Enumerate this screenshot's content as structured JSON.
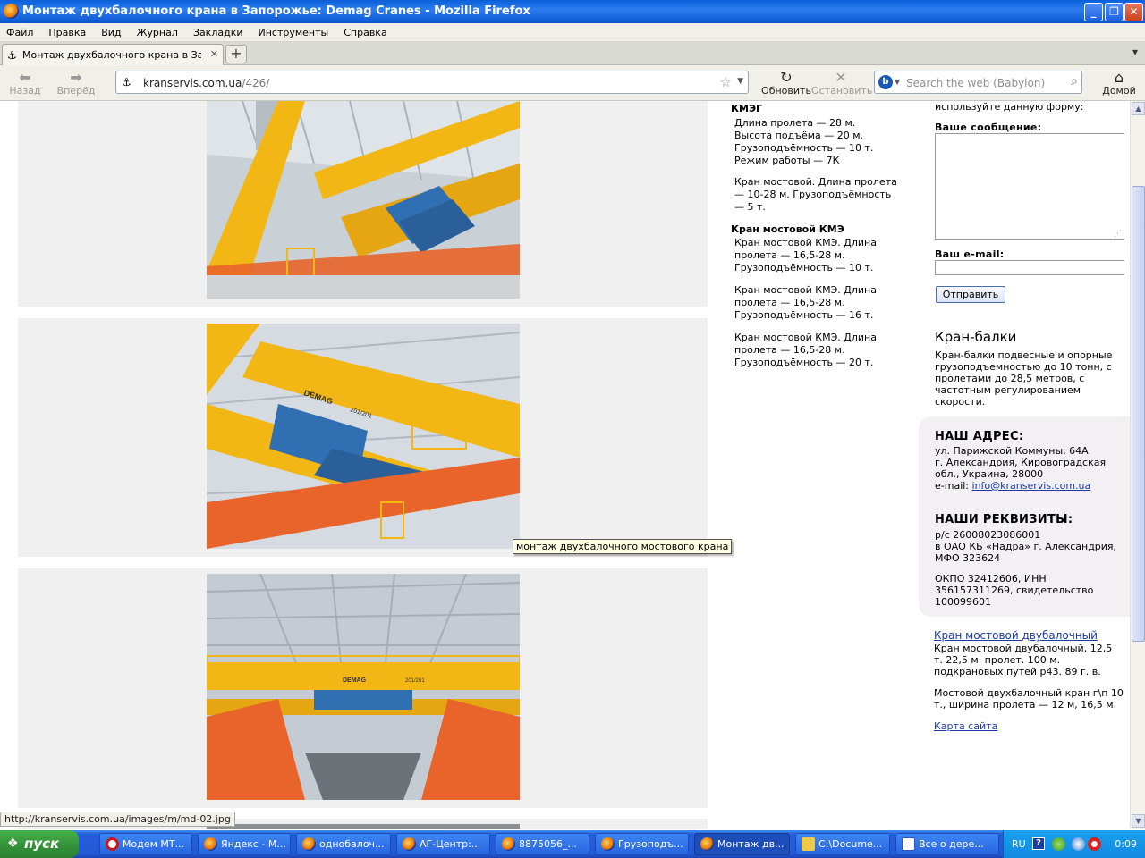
{
  "window": {
    "title": "Монтаж двухбалочного крана в Запорожье: Demag Cranes - Mozilla Firefox"
  },
  "menu": [
    "Файл",
    "Правка",
    "Вид",
    "Журнал",
    "Закладки",
    "Инструменты",
    "Справка"
  ],
  "tab": {
    "label": "Монтаж двухбалочного крана в Запорож...",
    "new_tab": "+"
  },
  "nav": {
    "back": "Назад",
    "forward": "Вперёд",
    "url_host": "kranservis.com.ua",
    "url_path": "/426/",
    "reload": "Обновить",
    "stop": "Остановить",
    "search_placeholder": "Search the web (Babylon)",
    "home": "Домой"
  },
  "tooltip": "монтаж двухбалочного мостового крана",
  "middle": {
    "heading1": "КМЭГ",
    "p1": "Длина пролета — 28 м. Высота подъёма — 20 м. Грузоподъёмность — 10 т. Режим работы — 7К",
    "p2": "Кран мостовой. Длина пролета — 10-28 м. Грузоподъёмность — 5 т.",
    "heading2": "Кран мостовой КМЭ",
    "p3": "Кран мостовой КМЭ. Длина пролета — 16,5-28 м. Грузоподъёмность — 10 т.",
    "p4": "Кран мостовой КМЭ. Длина пролета — 16,5-28 м. Грузоподъёмность — 16 т.",
    "p5": "Кран мостовой КМЭ. Длина пролета — 16,5-28 м. Грузоподъёмность — 20 т."
  },
  "form": {
    "intro": "используйте данную форму:",
    "message_label": "Ваше сообщение:",
    "email_label": "Ваш e-mail:",
    "submit": "Отправить"
  },
  "kran_balki": {
    "title": "Кран-балки",
    "text": "Кран-балки подвесные и опорные грузоподъемностью до 10 тонн, с пролетами до 28,5 метров, с частотным регулированием скорости."
  },
  "address": {
    "title": "НАШ АДРЕС:",
    "line1": "ул. Парижской Коммуны, 64А",
    "line2": "г. Александрия, Кировоградская обл., Украина, 28000",
    "email_prefix": "e-mail: ",
    "email": "info@kranservis.com.ua"
  },
  "requisites": {
    "title": "НАШИ РЕКВИЗИТЫ:",
    "line1": "р/с 26008023086001",
    "line2": "в ОАО КБ «Надра» г. Александрия, МФО 323624",
    "line3": "ОКПО 32412606, ИНН 356157311269, свидетельство 100099601"
  },
  "bridge": {
    "link": "Кран мостовой двубалочный",
    "text1": "Кран мостовой двубалочный, 12,5 т. 22,5 м. пролет. 100 м. подкрановых путей р43. 89 г. в.",
    "text2": "Мостовой двухбалочный кран г\\п 10 т., ширина пролета — 12 м, 16,5 м.",
    "sitemap": "Карта сайта"
  },
  "photo_labels": {
    "demag1": "DEMAG",
    "num1": "201/201",
    "demag2": "DEMAG",
    "num2": "201/201"
  },
  "status": "http://kranservis.com.ua/images/m/md-02.jpg",
  "taskbar": {
    "start": "пуск",
    "tasks": [
      "Модем МТ...",
      "Яндекс - М...",
      "однобалоч...",
      "АГ-Центр:...",
      "8875056_...",
      "Грузоподъ...",
      "Монтаж дв...",
      "C:\\Docume...",
      "Все о дере..."
    ],
    "lang": "RU",
    "time": "0:09"
  },
  "colors": {
    "crane_yellow": "#f3b715",
    "rail_orange": "#e8642a",
    "trolley_blue": "#2f6fb2",
    "link": "#1a3aa8"
  }
}
